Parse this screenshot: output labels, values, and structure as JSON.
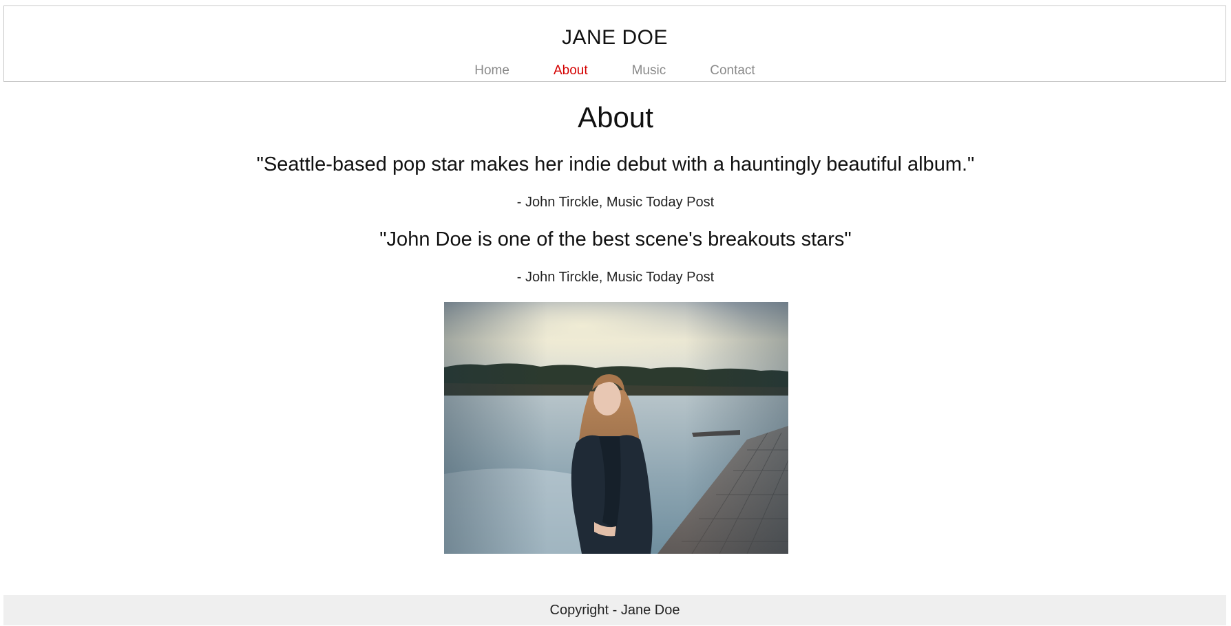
{
  "header": {
    "site_title": "JANE DOE",
    "nav": [
      {
        "label": "Home",
        "active": false
      },
      {
        "label": "About",
        "active": true
      },
      {
        "label": "Music",
        "active": false
      },
      {
        "label": "Contact",
        "active": false
      }
    ]
  },
  "main": {
    "page_title": "About",
    "quotes": [
      {
        "text": "\"Seattle-based pop star makes her indie debut with a hauntingly beautiful album.\"",
        "attribution": "- John Tirckle, Music Today Post"
      },
      {
        "text": "\"John Doe is one of the best scene's breakouts stars\"",
        "attribution": "- John Tirckle, Music Today Post"
      }
    ]
  },
  "footer": {
    "copyright": "Copyright - Jane Doe"
  },
  "colors": {
    "nav_active": "#d40000",
    "nav_inactive": "#8a8a8a",
    "footer_bg": "#efefef"
  }
}
